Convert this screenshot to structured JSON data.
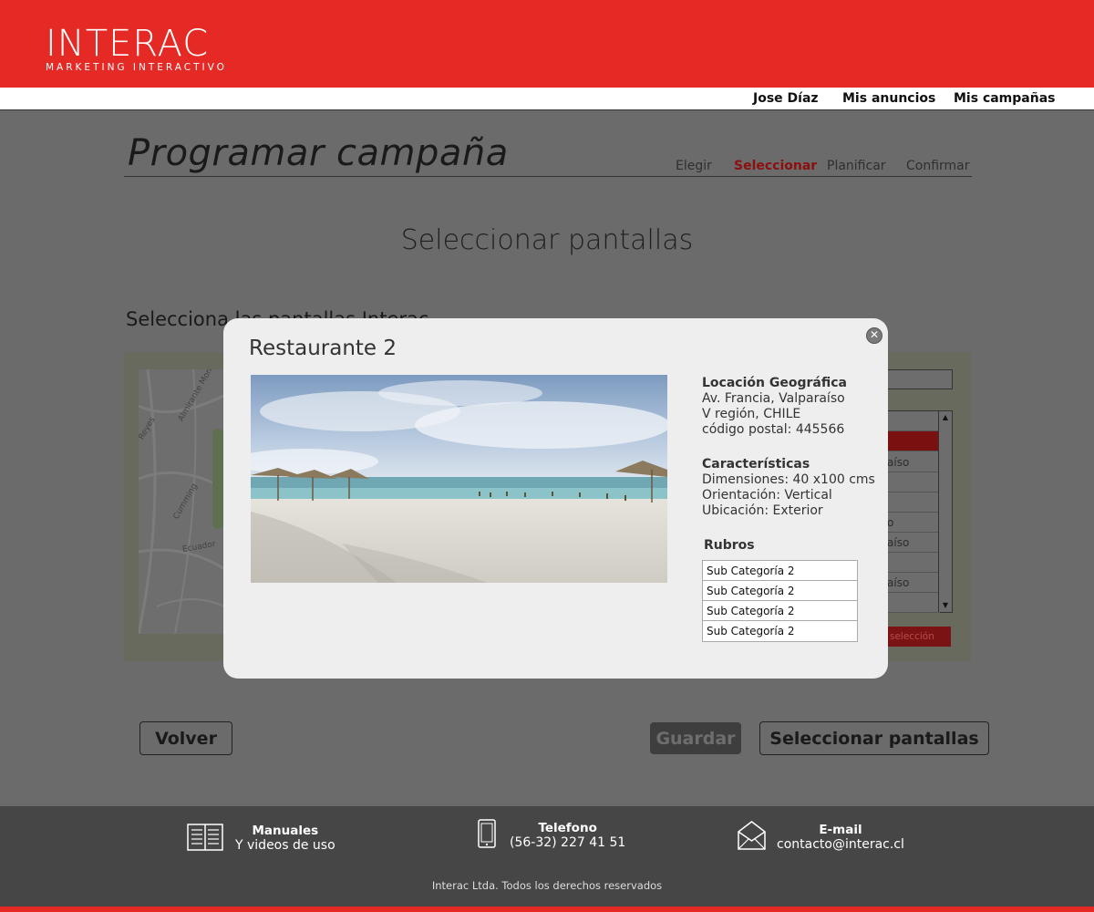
{
  "brand": {
    "name": "INTERAC",
    "tagline": "MARKETING INTERACTIVO",
    "accent_color": "#e52a25"
  },
  "nav": {
    "user": "Jose Díaz",
    "ads": "Mis anuncios",
    "campaigns": "Mis campañas"
  },
  "page": {
    "title": "Programar campaña",
    "steps": [
      "Elegir",
      "Seleccionar",
      "Planificar",
      "Confirmar"
    ],
    "active_step": "Seleccionar",
    "section_title": "Seleccionar pantallas",
    "sub_title": "Selecciona las pantallas Interac"
  },
  "map": {
    "labels": [
      "Almirante Montt",
      "Reyes",
      "Ecuador",
      "Cumming"
    ]
  },
  "list": {
    "rows": [
      "",
      "",
      "aíso",
      "",
      "",
      "o",
      "aíso",
      "",
      "aíso",
      ""
    ],
    "selected_index": 1,
    "action_label": "selección"
  },
  "buttons": {
    "back": "Volver",
    "save": "Guardar",
    "select": "Seleccionar pantallas"
  },
  "modal": {
    "title": "Restaurante 2",
    "location_heading": "Locación Geográfica",
    "location_lines": [
      "Av. Francia, Valparaíso",
      "V región, CHILE",
      "código postal: 445566"
    ],
    "features_heading": "Características",
    "features_lines": [
      "Dimensiones: 40 x100 cms",
      "Orientación: Vertical",
      "Ubicación: Exterior"
    ],
    "rubros_heading": "Rubros",
    "rubros": [
      "Sub Categoría 2",
      "Sub Categoría 2",
      "Sub Categoría 2",
      "Sub Categoría 2"
    ],
    "close_icon": "close-icon"
  },
  "footer": {
    "manuals_heading": "Manuales",
    "manuals_sub": "Y videos de uso",
    "phone_heading": "Telefono",
    "phone_value": "(56-32) 227 41 51",
    "email_heading": "E-mail",
    "email_value": "contacto@interac.cl",
    "copyright": "Interac Ltda. Todos los derechos reservados"
  }
}
